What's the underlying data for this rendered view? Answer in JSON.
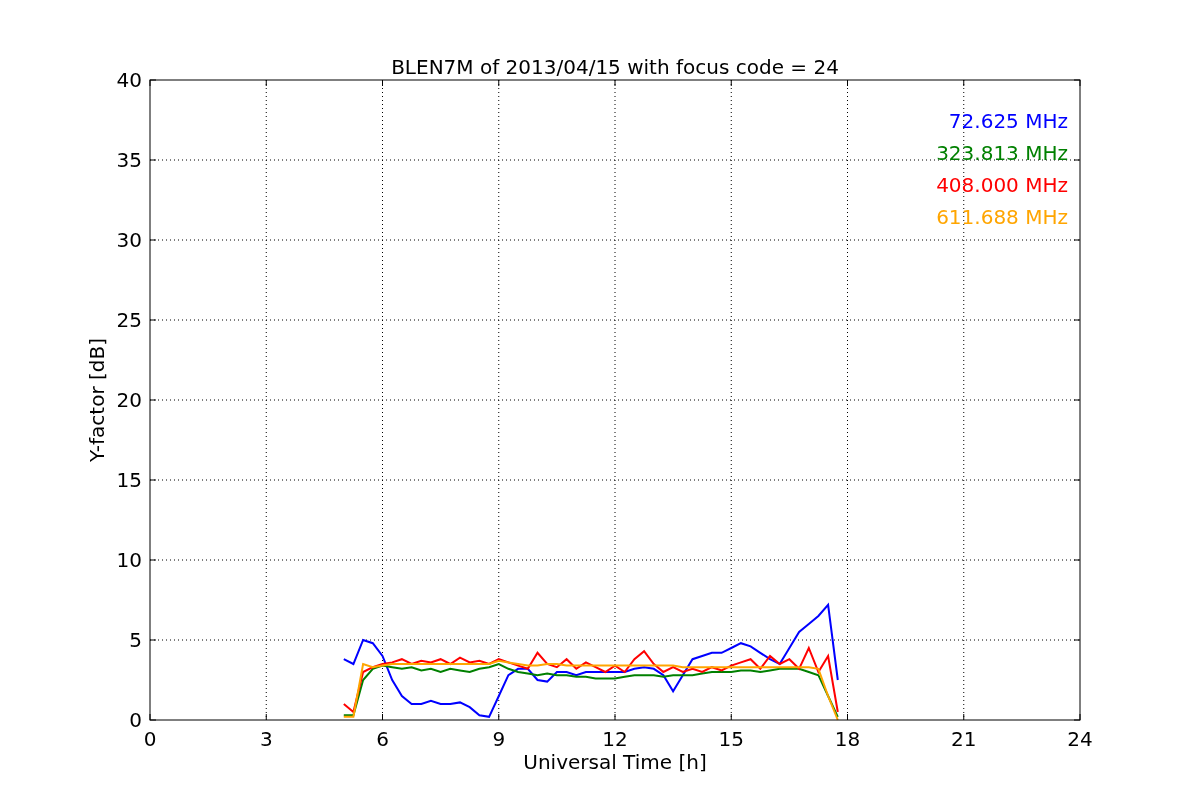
{
  "figure": {
    "chart_data": {
      "type": "line",
      "title": "BLEN7M of 2013/04/15 with focus code = 24",
      "xlabel": "Universal Time [h]",
      "ylabel": "Y-factor [dB]",
      "x": [
        5,
        5.25,
        5.5,
        5.75,
        6,
        6.25,
        6.5,
        6.75,
        7,
        7.25,
        7.5,
        7.75,
        8,
        8.25,
        8.5,
        8.75,
        9,
        9.25,
        9.5,
        9.75,
        10,
        10.25,
        10.5,
        10.75,
        11,
        11.25,
        11.5,
        11.75,
        12,
        12.25,
        12.5,
        12.75,
        13,
        13.25,
        13.5,
        13.75,
        14,
        14.25,
        14.5,
        14.75,
        15,
        15.25,
        15.5,
        15.75,
        16,
        16.25,
        16.5,
        16.75,
        17,
        17.25,
        17.5,
        17.75
      ],
      "series": [
        {
          "name": "72.625 MHz",
          "color": "#0000ff",
          "values": [
            3.8,
            3.5,
            5.0,
            4.8,
            4.0,
            2.5,
            1.5,
            1.0,
            1.0,
            1.2,
            1.0,
            1.0,
            1.1,
            0.8,
            0.3,
            0.2,
            1.5,
            2.8,
            3.2,
            3.2,
            2.5,
            2.4,
            3.0,
            3.0,
            2.8,
            3.0,
            3.0,
            3.0,
            3.0,
            3.0,
            3.2,
            3.3,
            3.2,
            2.8,
            1.8,
            2.8,
            3.8,
            4.0,
            4.2,
            4.2,
            4.5,
            4.8,
            4.6,
            4.2,
            3.8,
            3.5,
            4.5,
            5.5,
            6.0,
            6.5,
            7.2,
            2.5
          ]
        },
        {
          "name": "323.813 MHz",
          "color": "#008000",
          "values": [
            0.3,
            0.3,
            2.5,
            3.2,
            3.4,
            3.3,
            3.2,
            3.3,
            3.1,
            3.2,
            3.0,
            3.2,
            3.1,
            3.0,
            3.2,
            3.3,
            3.5,
            3.2,
            3.0,
            2.9,
            2.8,
            2.9,
            2.8,
            2.8,
            2.7,
            2.7,
            2.6,
            2.6,
            2.6,
            2.7,
            2.8,
            2.8,
            2.8,
            2.7,
            2.8,
            2.8,
            2.8,
            2.9,
            3.0,
            3.0,
            3.0,
            3.1,
            3.1,
            3.0,
            3.1,
            3.2,
            3.2,
            3.2,
            3.0,
            2.8,
            1.5,
            0.2
          ]
        },
        {
          "name": "408.000 MHz",
          "color": "#ff0000",
          "values": [
            1.0,
            0.5,
            3.0,
            3.3,
            3.5,
            3.6,
            3.8,
            3.5,
            3.7,
            3.6,
            3.8,
            3.5,
            3.9,
            3.6,
            3.7,
            3.5,
            3.8,
            3.6,
            3.4,
            3.2,
            4.2,
            3.5,
            3.3,
            3.8,
            3.2,
            3.6,
            3.3,
            3.0,
            3.4,
            3.0,
            3.8,
            4.3,
            3.5,
            3.0,
            3.3,
            3.0,
            3.2,
            3.0,
            3.3,
            3.1,
            3.4,
            3.6,
            3.8,
            3.2,
            4.0,
            3.5,
            3.8,
            3.2,
            4.5,
            3.0,
            4.0,
            0.5
          ]
        },
        {
          "name": "611.688 MHz",
          "color": "#ffa500",
          "values": [
            0.2,
            0.2,
            3.5,
            3.3,
            3.4,
            3.5,
            3.5,
            3.5,
            3.5,
            3.5,
            3.5,
            3.5,
            3.5,
            3.5,
            3.5,
            3.5,
            3.7,
            3.6,
            3.5,
            3.4,
            3.4,
            3.5,
            3.5,
            3.4,
            3.4,
            3.4,
            3.4,
            3.4,
            3.4,
            3.4,
            3.4,
            3.4,
            3.4,
            3.4,
            3.4,
            3.3,
            3.3,
            3.3,
            3.3,
            3.3,
            3.3,
            3.3,
            3.3,
            3.3,
            3.3,
            3.3,
            3.3,
            3.3,
            3.3,
            3.2,
            1.5,
            0.0
          ]
        }
      ],
      "xlim": [
        0,
        24
      ],
      "ylim": [
        0,
        40
      ],
      "xticks": [
        0,
        3,
        6,
        9,
        12,
        15,
        18,
        21,
        24
      ],
      "yticks": [
        0,
        5,
        10,
        15,
        20,
        25,
        30,
        35,
        40
      ],
      "grid": true
    }
  }
}
